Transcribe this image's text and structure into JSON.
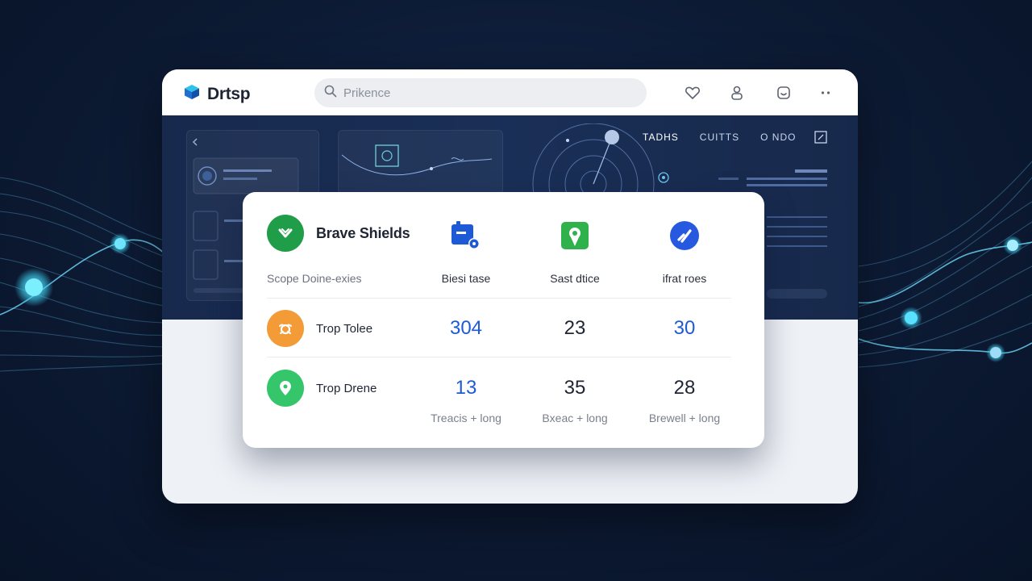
{
  "browser": {
    "brand_name": "Drtsp",
    "search_placeholder": "Prikence",
    "toolbar_icons": [
      "heart-icon",
      "user-icon",
      "tab-icon",
      "more-icon"
    ]
  },
  "dashboard": {
    "tabs": [
      "TADHS",
      "CUITTS",
      "O NDO"
    ]
  },
  "shields_card": {
    "title": "Brave Shields",
    "subtitle": "Scope Doine-exies",
    "columns": [
      {
        "label": "Biesi tase",
        "icon": "shield-badge-icon",
        "color": "#1e5ad6"
      },
      {
        "label": "Sast dtice",
        "icon": "location-pin-icon",
        "color": "#2fb24c"
      },
      {
        "label": "ifrat roes",
        "icon": "check-circle-icon",
        "color": "#2659e0"
      }
    ],
    "rows": [
      {
        "label": "Trop Tolee",
        "icon": "bug-icon",
        "icon_color": "#f39b37",
        "values": [
          "304",
          "23",
          "30"
        ]
      },
      {
        "label": "Trop Drene",
        "icon": "pin-icon",
        "icon_color": "#35c56a",
        "values": [
          "13",
          "35",
          "28"
        ]
      }
    ],
    "footer": [
      "Treacis + long",
      "Bxeac + long",
      "Brewell + long"
    ]
  }
}
